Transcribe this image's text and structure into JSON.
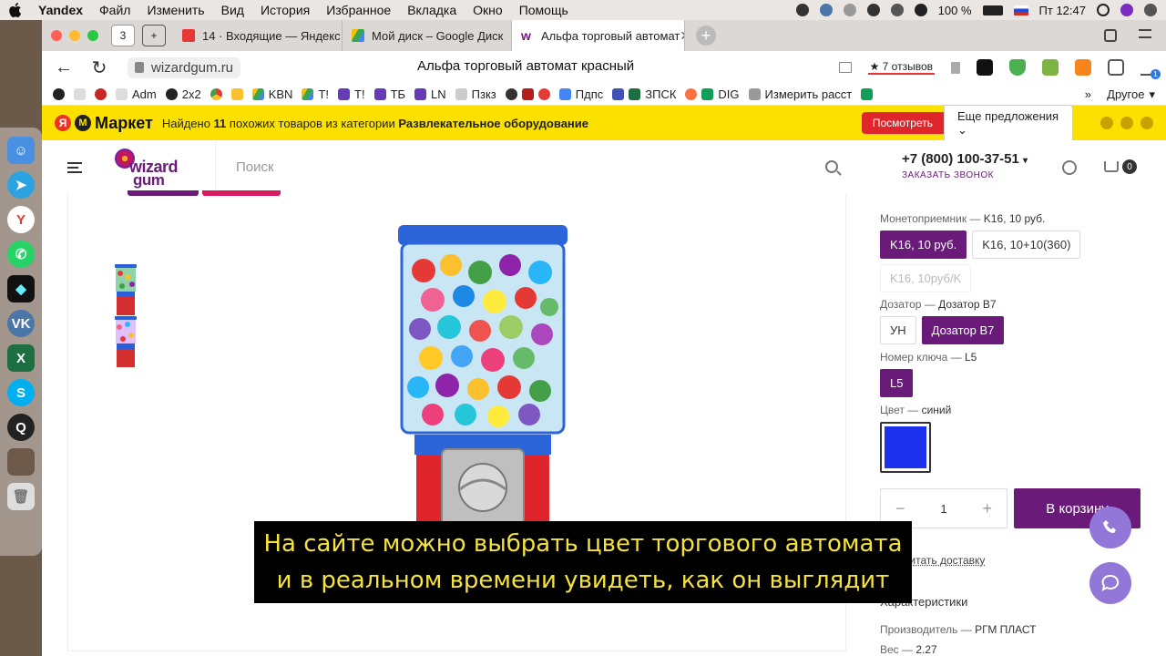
{
  "menubar": {
    "app": "Yandex",
    "items": [
      "Файл",
      "Изменить",
      "Вид",
      "История",
      "Избранное",
      "Вкладка",
      "Окно",
      "Помощь"
    ],
    "battery": "100 %",
    "datetime": "Пт 12:47"
  },
  "tabs": [
    {
      "label": "14 · Входящие — Яндекс",
      "favicon_color": "#e53935"
    },
    {
      "label": "Мой диск – Google Диск",
      "favicon_color": "#1e88e5"
    },
    {
      "label": "Альфа торговый автомат",
      "favicon_color": "#6a1b7a",
      "active": true
    }
  ],
  "tab_counter": "3",
  "address": {
    "url": "wizardgum.ru",
    "page_title": "Альфа торговый автомат красный",
    "reviews": "7 отзывов",
    "ext_badge": "1"
  },
  "bookmarks": [
    "Adm",
    "2x2",
    "KBN",
    "T!",
    "T!",
    "ТБ",
    "LN",
    "Пзкз",
    "Пдпс",
    "ЗПСК",
    "DIG",
    "Измерить расст",
    "Другое"
  ],
  "yandex_market": {
    "logo": "Маркет",
    "text_pre": "Найдено ",
    "count": "11",
    "text_mid": " похожих товаров",
    "text_cat": " из категории ",
    "category": "Развлекательное оборудование",
    "look_button": "Посмотреть",
    "more_button": "Еще предложения"
  },
  "site": {
    "logo_line1": "wizard",
    "logo_line2": "gum",
    "search_placeholder": "Поиск",
    "phone": "+7 (800) 100-37-51",
    "callback": "ЗАКАЗАТЬ ЗВОНОК",
    "cart_count": "0"
  },
  "options": {
    "coin": {
      "label": "Монетоприемник",
      "value": "K16, 10 руб.",
      "buttons": [
        "K16, 10 руб.",
        "K16, 10+10(360)",
        "K16, 10руб/K"
      ]
    },
    "dispenser": {
      "label": "Дозатор",
      "value": "Дозатор B7",
      "buttons": [
        "УН",
        "Дозатор B7"
      ]
    },
    "key": {
      "label": "Номер ключа",
      "value": "L5",
      "buttons": [
        "L5"
      ]
    },
    "color": {
      "label": "Цвет",
      "value": "синий",
      "swatch": "#1d32ef"
    },
    "qty": "1",
    "to_cart": "В корзину",
    "delivery": "Рассчитать доставку",
    "characteristics": "Характеристики",
    "manufacturer_label": "Производитель",
    "manufacturer": "РГМ ПЛАСТ",
    "weight_label": "Вес",
    "weight": "2.27"
  },
  "subtitle": {
    "line1": "На сайте можно выбрать цвет торгового автомата",
    "line2": "и в реальном времени увидеть, как он выглядит"
  },
  "colors": {
    "brand": "#6a1b7a",
    "accent": "#d81b60",
    "ym_yellow": "#fce000",
    "fab": "#9277d8"
  }
}
